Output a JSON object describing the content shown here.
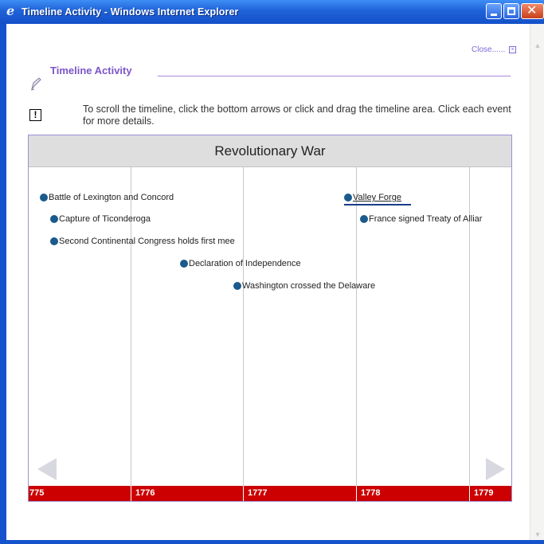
{
  "window": {
    "title": "Timeline Activity - Windows Internet Explorer",
    "minimize_icon": "minimize-icon",
    "maximize_icon": "maximize-icon",
    "close_icon": "close-icon",
    "titlebar_color": "#1f62d8"
  },
  "activity": {
    "close_label": "Close",
    "close_dots": "......",
    "title": "Timeline Activity",
    "instructions": "To scroll the timeline, click the bottom arrows or click and drag the timeline area. Click each event for more details.",
    "accent_color": "#7b55c8"
  },
  "timeline": {
    "heading": "Revolutionary War",
    "events": [
      {
        "label": "Battle of Lexington and Concord",
        "active": false
      },
      {
        "label": "Capture of Ticonderoga",
        "active": false
      },
      {
        "label": "Second Continental Congress holds first mee",
        "active": false
      },
      {
        "label": "Declaration of Independence",
        "active": false
      },
      {
        "label": "Washington crossed the Delaware",
        "active": false
      },
      {
        "label": "Valley Forge",
        "active": true
      },
      {
        "label": "France signed Treaty of Alliar",
        "active": false
      }
    ],
    "years": [
      "775",
      "1776",
      "1777",
      "1778",
      "1779"
    ],
    "year_bar_color": "#cc0000",
    "dot_color": "#1a5a8c"
  }
}
